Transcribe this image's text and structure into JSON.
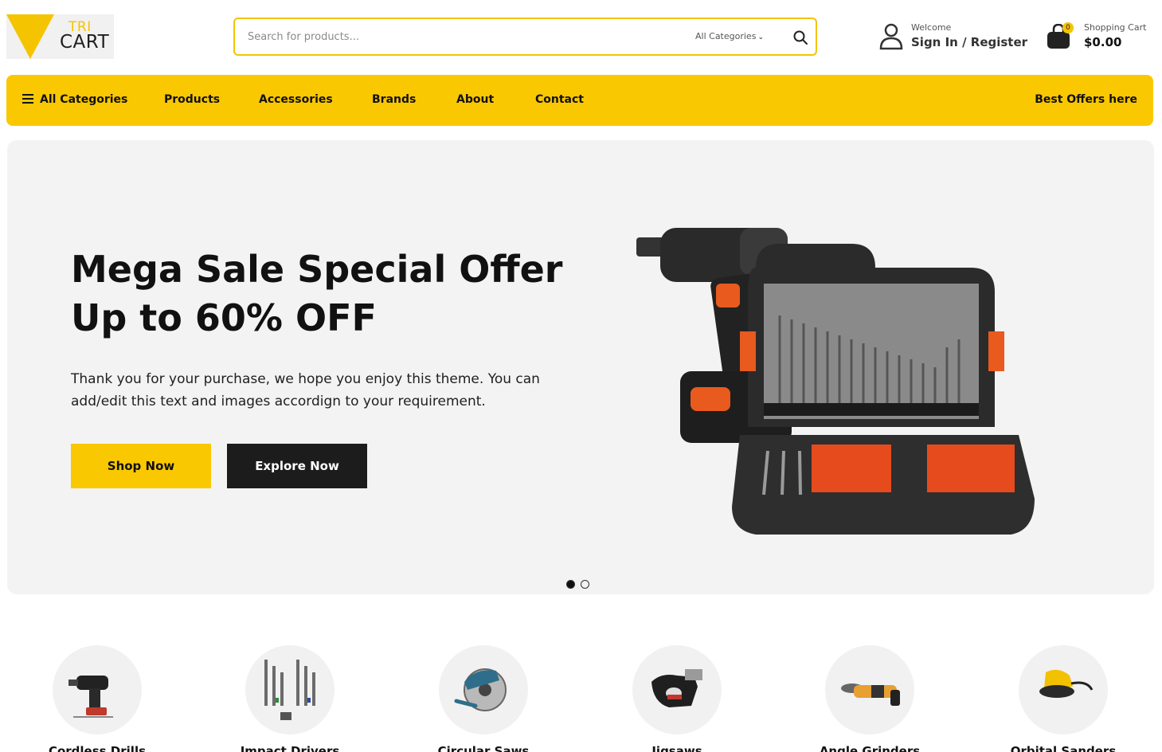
{
  "header": {
    "logo_top": "TRI",
    "logo_bottom": "CART",
    "search_placeholder": "Search for products...",
    "category_select": "All Categories",
    "welcome": "Welcome",
    "sign_in_register": "Sign In / Register",
    "cart_label": "Shopping Cart",
    "cart_amount": "$0.00",
    "cart_count": "0"
  },
  "nav": {
    "all_categories": "All Categories",
    "items": [
      "Products",
      "Accessories",
      "Brands",
      "About",
      "Contact"
    ],
    "offers": "Best Offers here"
  },
  "hero": {
    "title_line1": "Mega Sale Special Offer",
    "title_line2": "Up to 60% OFF",
    "text": "Thank you for your purchase, we hope you enjoy this theme. You can add/edit this text and images accordign to your requirement.",
    "shop_now": "Shop Now",
    "explore_now": "Explore Now"
  },
  "categories": [
    {
      "name": "Cordless Drills",
      "icon": "drill-icon"
    },
    {
      "name": "Impact Drivers",
      "icon": "drill-bits-icon"
    },
    {
      "name": "Circular Saws",
      "icon": "circular-saw-icon"
    },
    {
      "name": "Jigsaws",
      "icon": "jigsaw-icon"
    },
    {
      "name": "Angle Grinders",
      "icon": "angle-grinder-icon"
    },
    {
      "name": "Orbital Sanders",
      "icon": "orbital-sander-icon"
    }
  ],
  "colors": {
    "accent": "#fac800",
    "dark": "#1c1c1c",
    "hero_bg": "#f3f3f3"
  }
}
